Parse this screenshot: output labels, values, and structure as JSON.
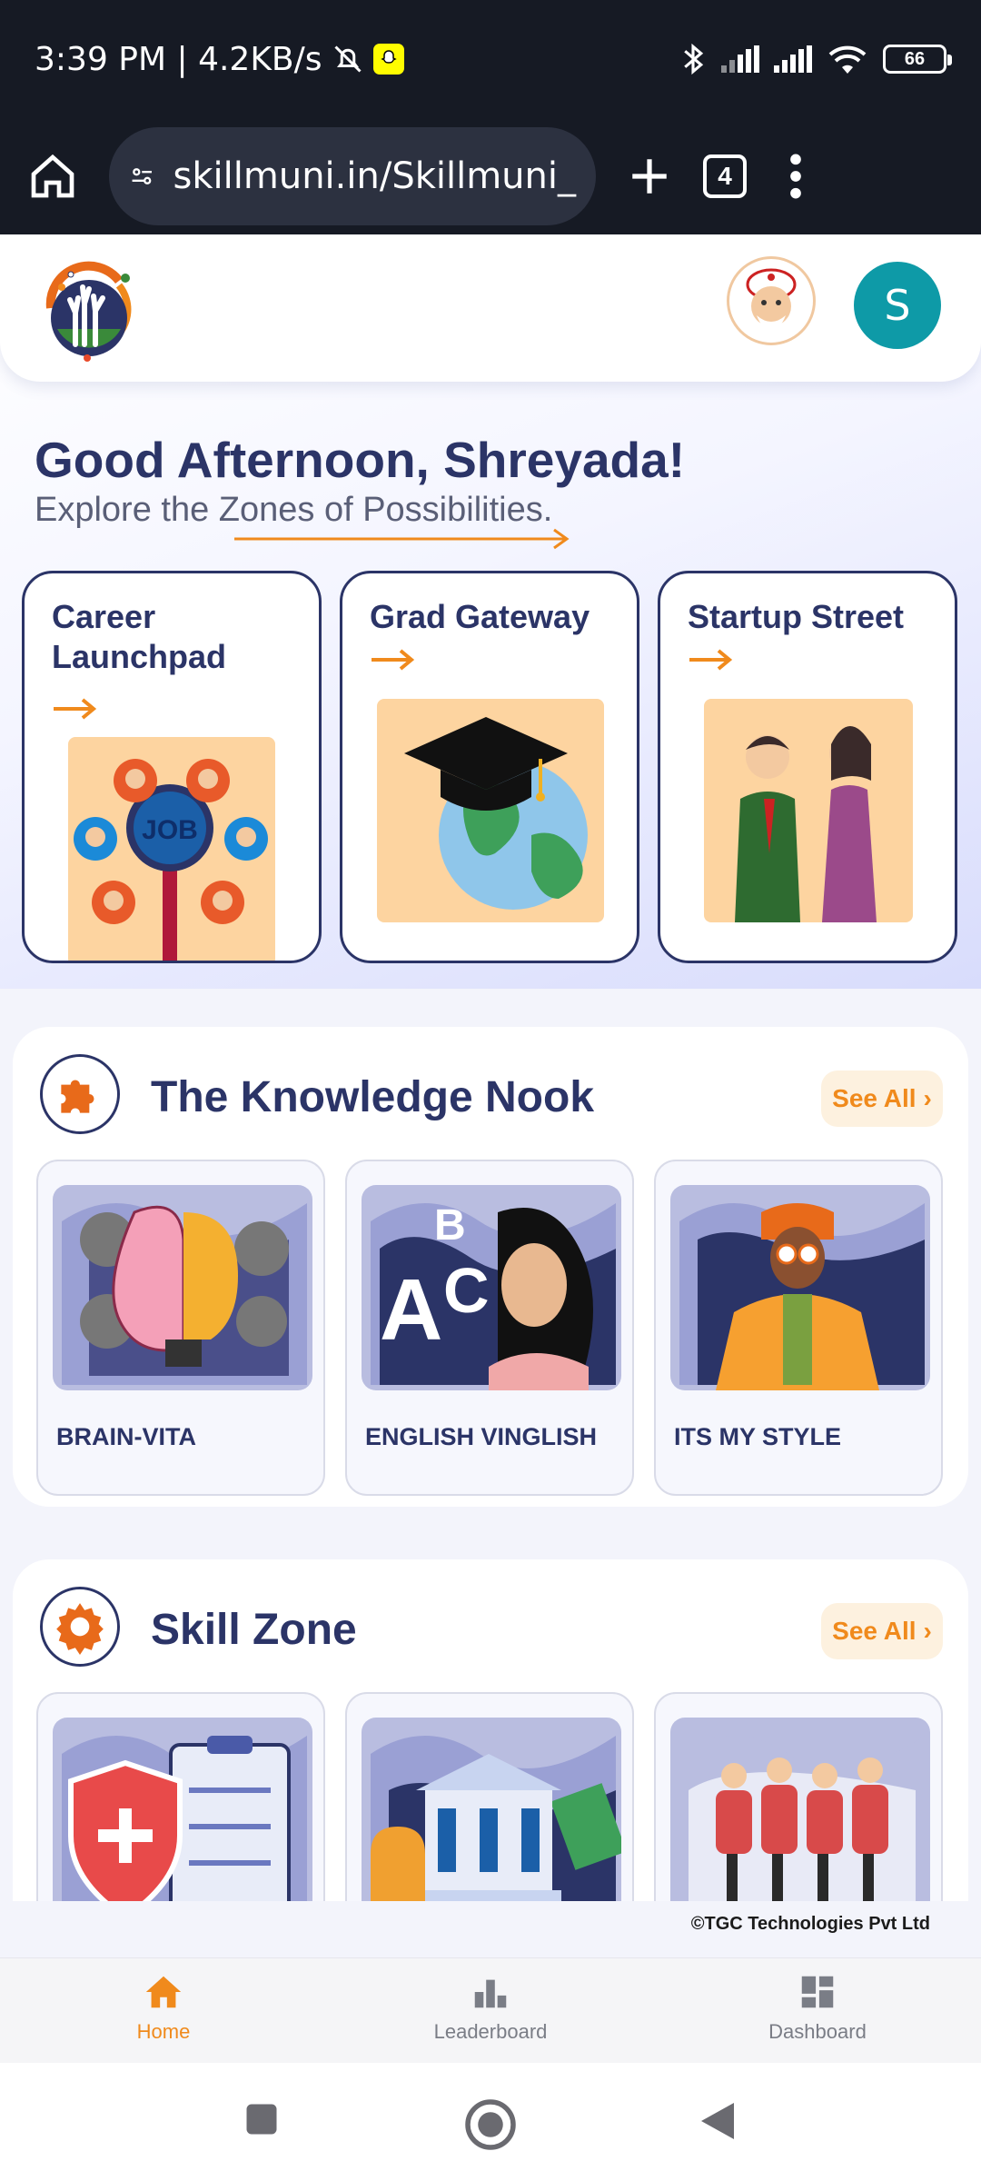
{
  "status_bar": {
    "time_speed": "3:39 PM | 4.2KB/s",
    "battery": "66",
    "icons": [
      "mute-bell-icon",
      "snapchat-icon",
      "bluetooth-icon",
      "signal-icon",
      "signal-icon",
      "wifi-icon",
      "battery-icon"
    ]
  },
  "browser": {
    "url": "skillmuni.in/Skillmuni_",
    "tab_count": "4",
    "icons": [
      "home-icon",
      "site-settings-icon",
      "new-tab-icon",
      "more-icon"
    ]
  },
  "header": {
    "avatar_initial": "S"
  },
  "hero": {
    "greeting": "Good Afternoon, Shreyada!",
    "subtitle": "Explore the Zones of Possibilities.",
    "zones": [
      {
        "title_line1": "Career",
        "title_line2": "Launchpad",
        "image": "job-search-illustration"
      },
      {
        "title_line1": "Grad Gateway",
        "image": "graduation-globe-illustration"
      },
      {
        "title_line1": "Startup Street",
        "image": "business-people-illustration"
      }
    ]
  },
  "knowledge_nook": {
    "title": "The Knowledge Nook",
    "see_all": "See All",
    "items": [
      {
        "label": "BRAIN-VITA",
        "image": "brain-gears-illustration"
      },
      {
        "label": "ENGLISH VINGLISH",
        "image": "abc-woman-illustration"
      },
      {
        "label": "ITS MY STYLE",
        "image": "fashion-woman-illustration"
      }
    ]
  },
  "skill_zone": {
    "title": "Skill Zone",
    "see_all": "See All",
    "items": [
      {
        "image": "health-shield-clipboard-illustration"
      },
      {
        "image": "bank-money-illustration"
      },
      {
        "image": "hospitality-staff-illustration"
      }
    ]
  },
  "footer": {
    "copyright": "©TGC Technologies Pvt Ltd"
  },
  "bottom_nav": {
    "items": [
      {
        "label": "Home",
        "icon": "home-icon",
        "active": true
      },
      {
        "label": "Leaderboard",
        "icon": "leaderboard-icon",
        "active": false
      },
      {
        "label": "Dashboard",
        "icon": "dashboard-icon",
        "active": false
      }
    ]
  },
  "colors": {
    "primary_navy": "#2b3467",
    "accent_orange": "#f08a1c",
    "avatar_teal": "#0e9aa7"
  }
}
